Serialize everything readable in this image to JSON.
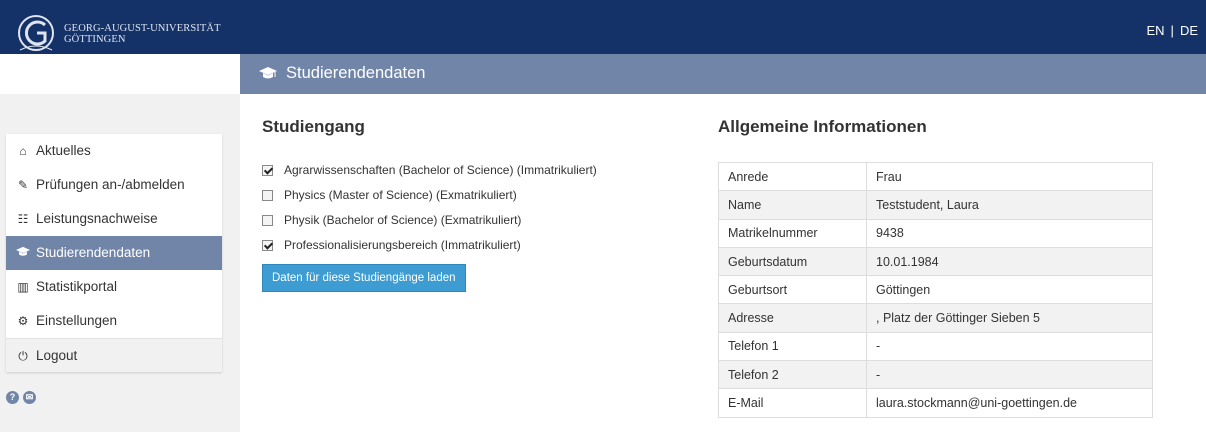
{
  "header": {
    "university_line1": "GEORG-AUGUST-UNIVERSITÄT",
    "university_line2": "GÖTTINGEN",
    "lang_en": "EN",
    "lang_sep": "|",
    "lang_de": "DE",
    "bg_color": "#153268"
  },
  "subheader": {
    "icon": "graduation-cap-icon",
    "title": "Studierendendaten"
  },
  "sidebar": {
    "items": [
      {
        "label": "Aktuelles",
        "icon": "home-icon",
        "glyph": "⌂"
      },
      {
        "label": "Prüfungen an-/abmelden",
        "icon": "edit-icon",
        "glyph": "✎"
      },
      {
        "label": "Leistungsnachweise",
        "icon": "list-icon",
        "glyph": "☷"
      },
      {
        "label": "Studierendendaten",
        "icon": "graduation-cap-icon",
        "glyph": "🎓",
        "active": true
      },
      {
        "label": "Statistikportal",
        "icon": "bar-chart-icon",
        "glyph": "▥"
      },
      {
        "label": "Einstellungen",
        "icon": "gear-icon",
        "glyph": "⚙"
      },
      {
        "label": "Logout",
        "icon": "power-icon",
        "glyph": "⏻"
      }
    ],
    "help_icons": [
      "help-icon",
      "mail-icon"
    ],
    "help_glyph": "?",
    "mail_glyph": "✉",
    "active_color": "#7185a8"
  },
  "studiengang": {
    "heading": "Studiengang",
    "items": [
      {
        "label": "Agrarwissenschaften (Bachelor of Science) (Immatrikuliert)",
        "checked": true
      },
      {
        "label": "Physics (Master of Science) (Exmatrikuliert)",
        "checked": false
      },
      {
        "label": "Physik (Bachelor of Science) (Exmatrikuliert)",
        "checked": false
      },
      {
        "label": "Professionalisierungsbereich (Immatrikuliert)",
        "checked": true
      }
    ],
    "button_label": "Daten für diese Studiengänge laden",
    "button_color": "#3d9cd1"
  },
  "info": {
    "heading": "Allgemeine Informationen",
    "rows": [
      {
        "key": "Anrede",
        "value": "Frau"
      },
      {
        "key": "Name",
        "value": "Teststudent, Laura"
      },
      {
        "key": "Matrikelnummer",
        "value": "9438"
      },
      {
        "key": "Geburtsdatum",
        "value": "10.01.1984"
      },
      {
        "key": "Geburtsort",
        "value": "Göttingen"
      },
      {
        "key": "Adresse",
        "value": ", Platz der Göttinger Sieben 5"
      },
      {
        "key": "Telefon 1",
        "value": "-"
      },
      {
        "key": "Telefon 2",
        "value": "-"
      },
      {
        "key": "E-Mail",
        "value": "laura.stockmann@uni-goettingen.de"
      }
    ]
  }
}
